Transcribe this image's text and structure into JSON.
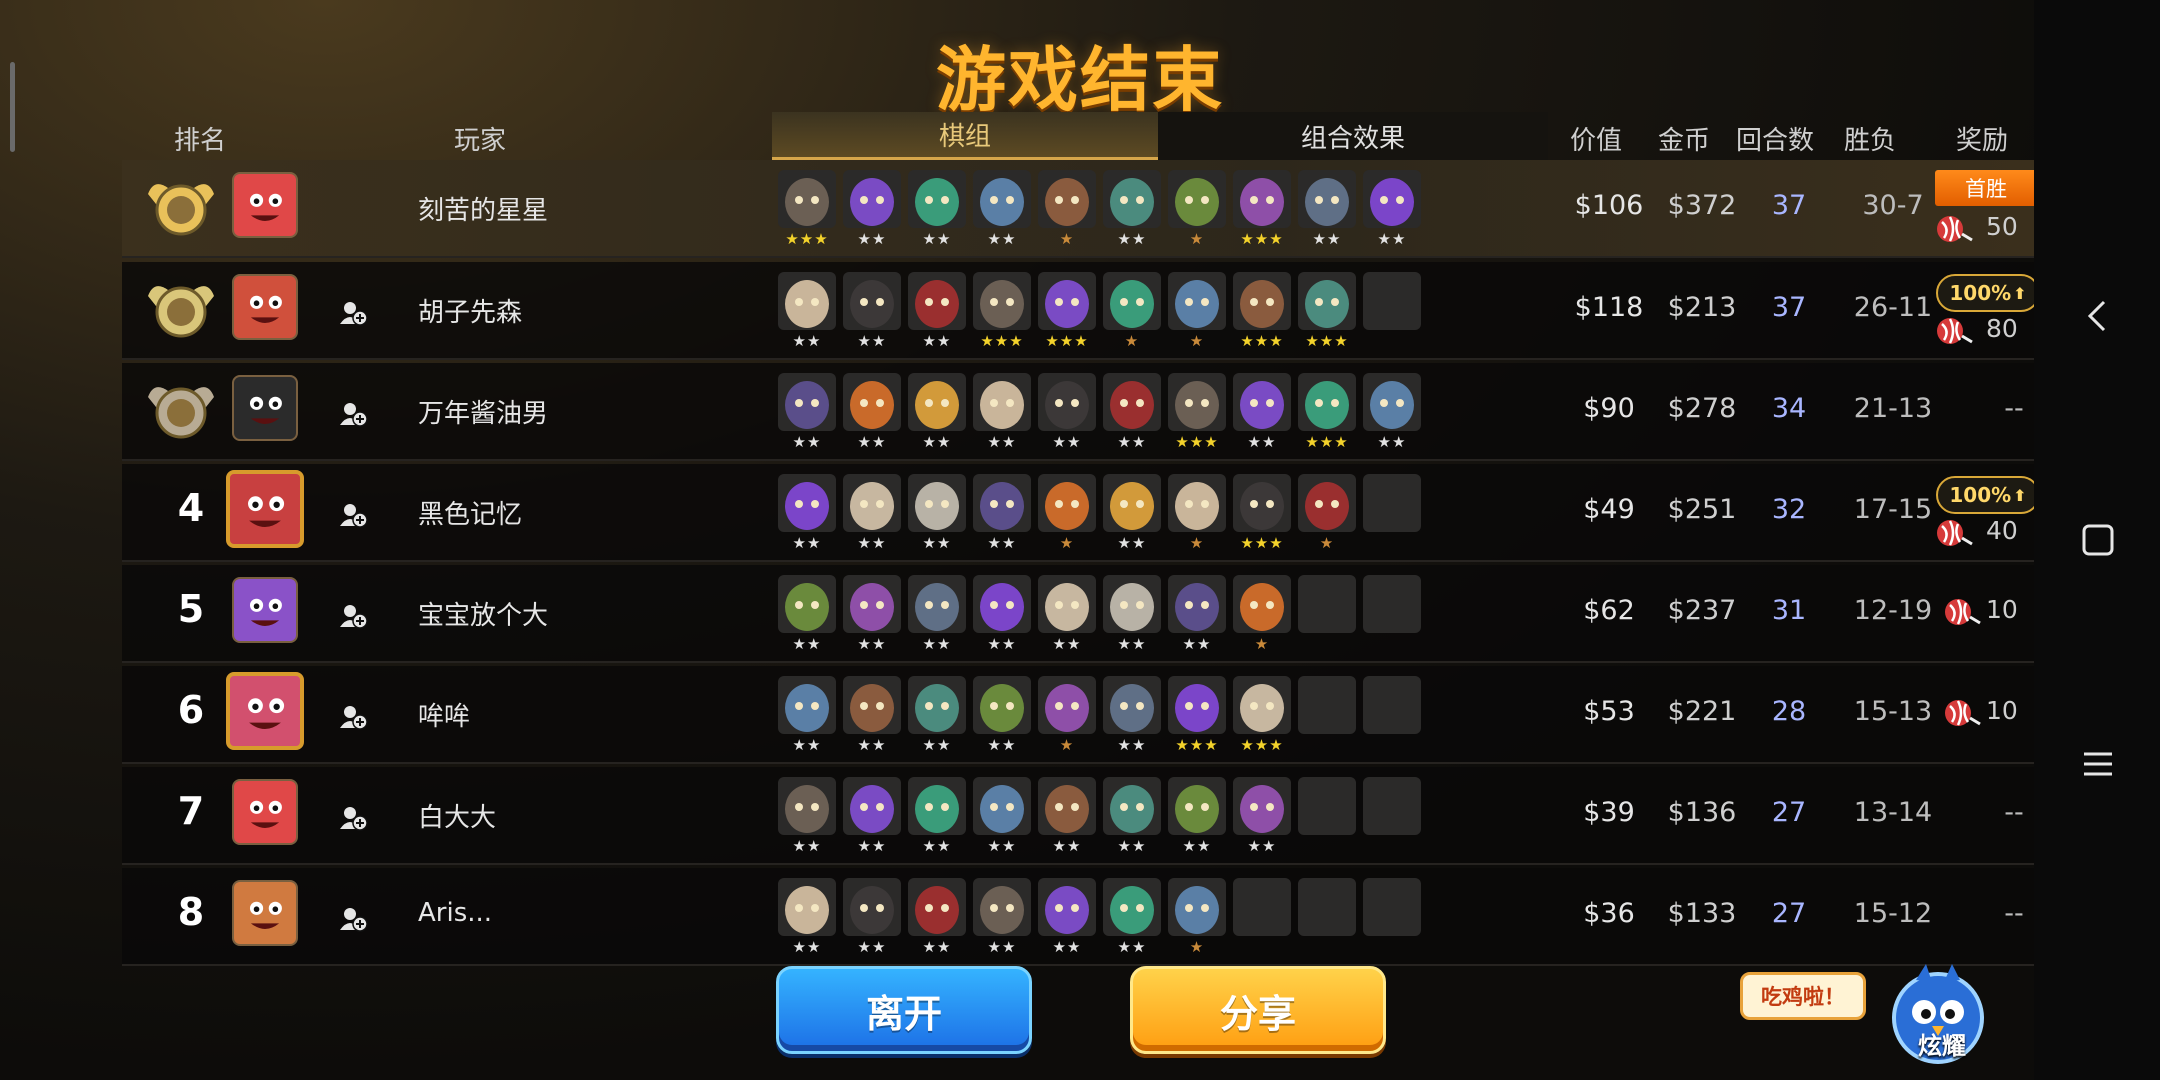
{
  "title": "游戏结束",
  "headers": {
    "rank": "排名",
    "player": "玩家",
    "board_tab": "棋组",
    "synergy_tab": "组合效果",
    "value": "价值",
    "gold": "金币",
    "rounds": "回合数",
    "winloss": "胜负",
    "reward": "奖励"
  },
  "rows": [
    {
      "rank": "1",
      "name": "刻苦的星星",
      "value": "$106",
      "gold": "$372",
      "rounds": "37",
      "wl": "30-7",
      "reward_tag": "首胜",
      "reward": "50",
      "units": [
        3,
        2,
        2,
        2,
        1,
        2,
        1,
        3,
        2,
        2
      ]
    },
    {
      "rank": "2",
      "name": "胡子先森",
      "value": "$118",
      "gold": "$213",
      "rounds": "37",
      "wl": "26-11",
      "reward_tag": "100%",
      "reward": "80",
      "units": [
        2,
        2,
        2,
        3,
        3,
        1,
        1,
        3,
        3,
        0
      ]
    },
    {
      "rank": "3",
      "name": "万年酱油男",
      "value": "$90",
      "gold": "$278",
      "rounds": "34",
      "wl": "21-13",
      "reward_tag": "",
      "reward": "--",
      "units": [
        2,
        2,
        2,
        2,
        2,
        2,
        3,
        2,
        3,
        2
      ]
    },
    {
      "rank": "4",
      "name": "黑色记忆",
      "value": "$49",
      "gold": "$251",
      "rounds": "32",
      "wl": "17-15",
      "reward_tag": "100%",
      "reward": "40",
      "units": [
        2,
        2,
        2,
        2,
        1,
        2,
        1,
        3,
        1,
        0
      ]
    },
    {
      "rank": "5",
      "name": "宝宝放个大",
      "value": "$62",
      "gold": "$237",
      "rounds": "31",
      "wl": "12-19",
      "reward_tag": "",
      "reward": "10",
      "units": [
        2,
        2,
        2,
        2,
        2,
        2,
        2,
        1,
        0,
        0
      ]
    },
    {
      "rank": "6",
      "name": "哞哞",
      "value": "$53",
      "gold": "$221",
      "rounds": "28",
      "wl": "15-13",
      "reward_tag": "",
      "reward": "10",
      "units": [
        2,
        2,
        2,
        2,
        1,
        2,
        3,
        3,
        0,
        0
      ]
    },
    {
      "rank": "7",
      "name": "白大大",
      "value": "$39",
      "gold": "$136",
      "rounds": "27",
      "wl": "13-14",
      "reward_tag": "",
      "reward": "--",
      "units": [
        2,
        2,
        2,
        2,
        2,
        2,
        2,
        2,
        0,
        0
      ]
    },
    {
      "rank": "8",
      "name": "Aris...",
      "value": "$36",
      "gold": "$133",
      "rounds": "27",
      "wl": "15-12",
      "reward_tag": "",
      "reward": "--",
      "units": [
        2,
        2,
        2,
        2,
        2,
        2,
        1,
        0,
        0,
        0
      ]
    }
  ],
  "buttons": {
    "leave": "离开",
    "share": "分享"
  },
  "bubble": "吃鸡啦！",
  "mascot_label": "炫耀",
  "colors": {
    "title": "#ffb52e",
    "leave": "#1c6fe6",
    "share": "#ff9d10",
    "rounds": "#a9b6ff",
    "reward_tag": "#ff8a1a"
  },
  "icons": {
    "friend": "add-friend-icon",
    "candy": "candy-icon",
    "nav": [
      "back-icon",
      "recent-apps-icon",
      "menu-icon"
    ]
  }
}
